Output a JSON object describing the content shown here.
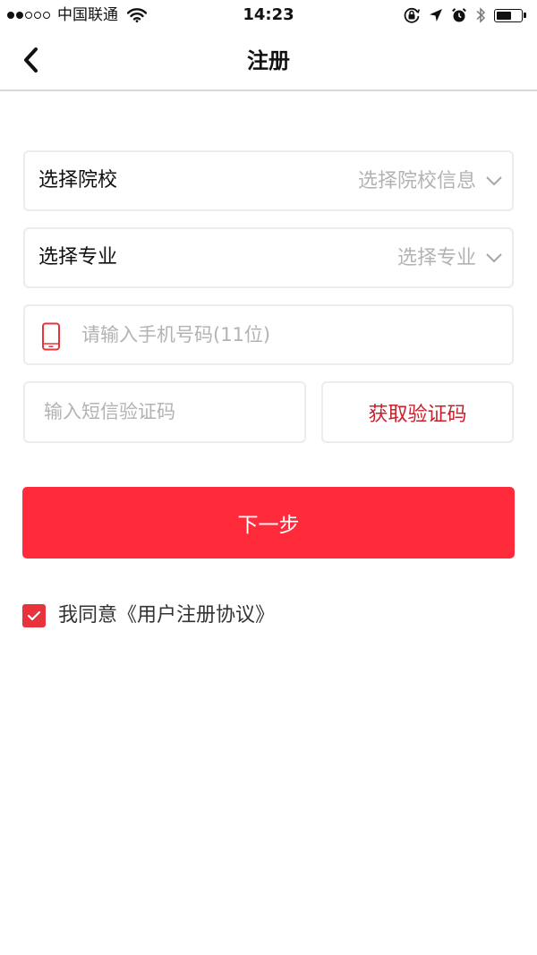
{
  "status_bar": {
    "carrier": "中国联通",
    "time": "14:23",
    "signal_bars_filled": 2,
    "signal_bars_total": 5,
    "icons": [
      "wifi-icon",
      "orientation-lock-icon",
      "location-arrow-icon",
      "alarm-icon",
      "bluetooth-icon",
      "battery-icon"
    ]
  },
  "nav": {
    "title": "注册",
    "back_icon": "chevron-left-icon"
  },
  "form": {
    "school": {
      "label": "选择院校",
      "value": "选择院校信息",
      "icon": "chevron-down-icon"
    },
    "major": {
      "label": "选择专业",
      "value": "选择专业",
      "icon": "chevron-down-icon"
    },
    "phone": {
      "placeholder": "请输入手机号码(11位)",
      "value": "",
      "icon": "mobile-phone-icon"
    },
    "sms_code": {
      "placeholder": "输入短信验证码",
      "value": ""
    },
    "get_code_label": "获取验证码",
    "next_label": "下一步",
    "agreement": {
      "checked": true,
      "text": "我同意《用户注册协议》"
    }
  },
  "colors": {
    "primary_red": "#ff2b3a",
    "link_red": "#c8202e",
    "placeholder_gray": "#b3b3b3",
    "border_gray": "#ececec"
  }
}
